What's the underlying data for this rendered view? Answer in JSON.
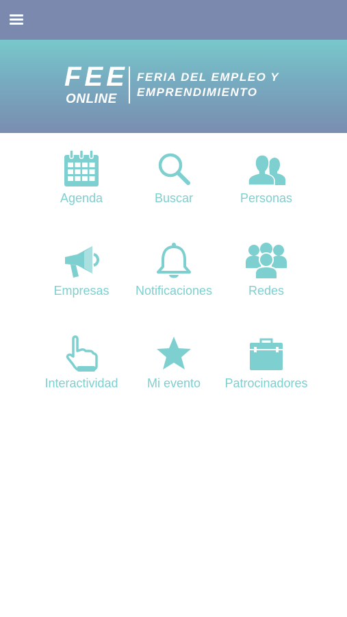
{
  "topbar": {
    "menu_icon": "hamburger-menu-icon",
    "background": "#7c89ae"
  },
  "banner": {
    "logo_main": "FEE",
    "logo_sub": "ONLINE",
    "tagline_line1": "FERIA DEL EMPLEO Y",
    "tagline_line2": "EMPRENDIMIENTO"
  },
  "accent_color": "#7ecfcf",
  "menu": {
    "items": [
      {
        "label": "Agenda",
        "icon": "calendar-icon"
      },
      {
        "label": "Buscar",
        "icon": "search-icon"
      },
      {
        "label": "Personas",
        "icon": "people-icon"
      },
      {
        "label": "Empresas",
        "icon": "megaphone-icon"
      },
      {
        "label": "Notificaciones",
        "icon": "bell-icon"
      },
      {
        "label": "Redes",
        "icon": "group-icon"
      },
      {
        "label": "Interactividad",
        "icon": "pointing-hand-icon"
      },
      {
        "label": "Mi evento",
        "icon": "star-icon"
      },
      {
        "label": "Patrocinadores",
        "icon": "briefcase-icon"
      }
    ]
  }
}
